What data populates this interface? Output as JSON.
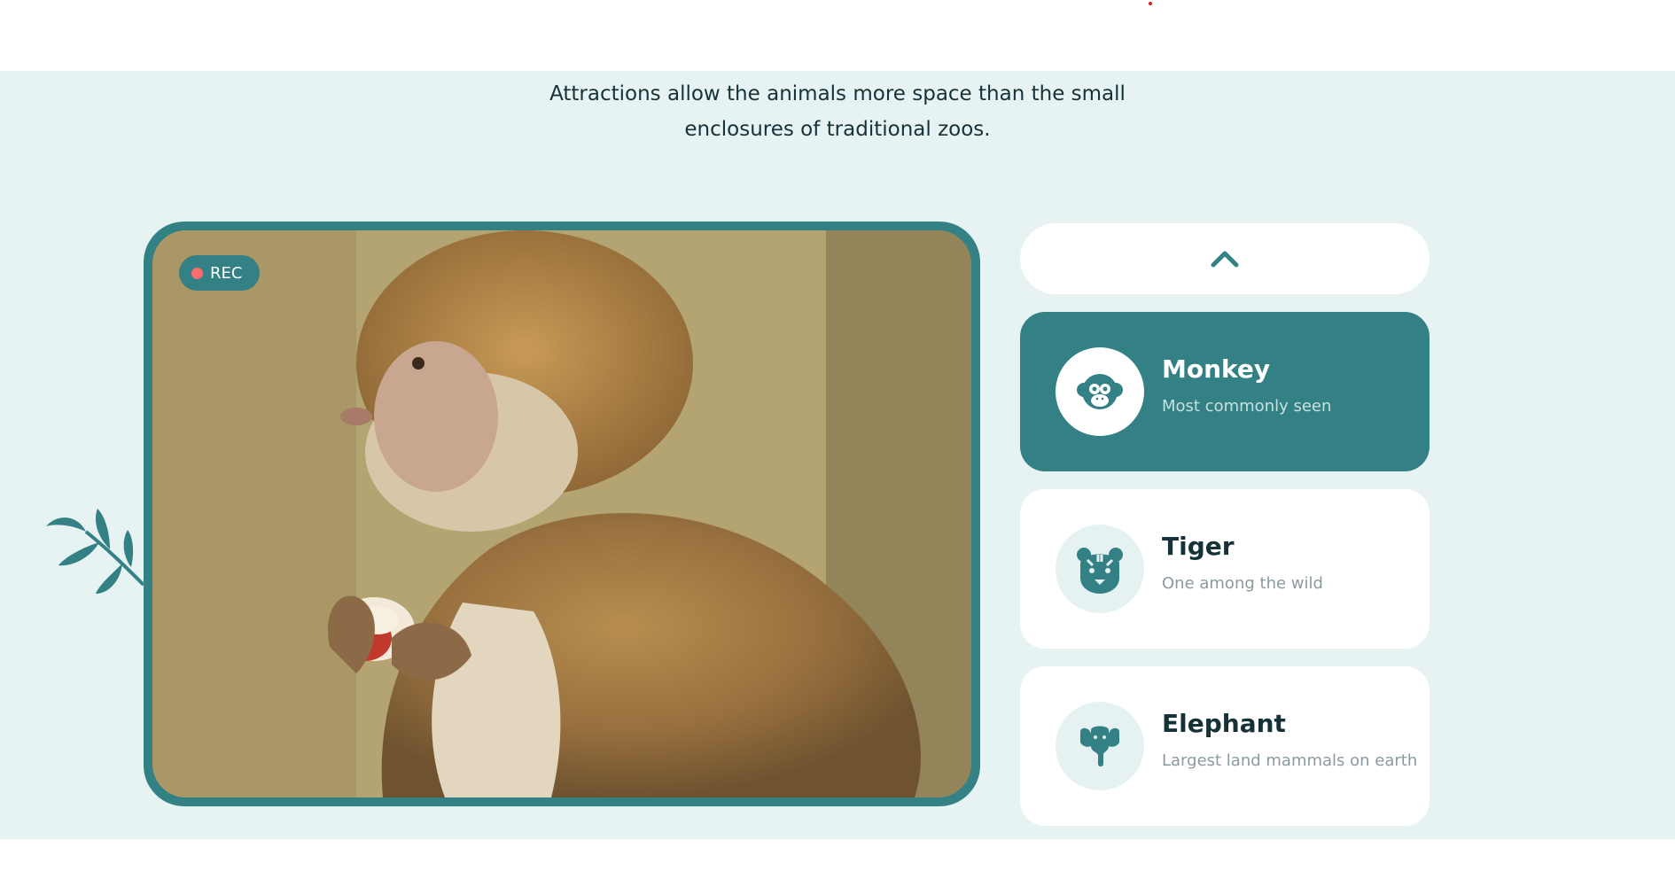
{
  "intro": {
    "line1": "Attractions allow the animals more space than the small",
    "line2": "enclosures of traditional zoos."
  },
  "viewer": {
    "badge_label": "REC",
    "image_subject": "monkey eating an apple"
  },
  "animals": [
    {
      "name": "Monkey",
      "subtitle": "Most commonly seen",
      "icon": "monkey-icon",
      "active": true
    },
    {
      "name": "Tiger",
      "subtitle": "One among the wild",
      "icon": "tiger-icon",
      "active": false
    },
    {
      "name": "Elephant",
      "subtitle": "Largest land mammals on earth",
      "icon": "elephant-icon",
      "active": false
    }
  ],
  "nav": {
    "up_icon": "chevron-up-icon"
  },
  "colors": {
    "accent": "#338185",
    "background": "#e7f3f3",
    "heading": "#163238",
    "muted": "#8a9aa0",
    "rec_dot": "#ff6b6b"
  }
}
